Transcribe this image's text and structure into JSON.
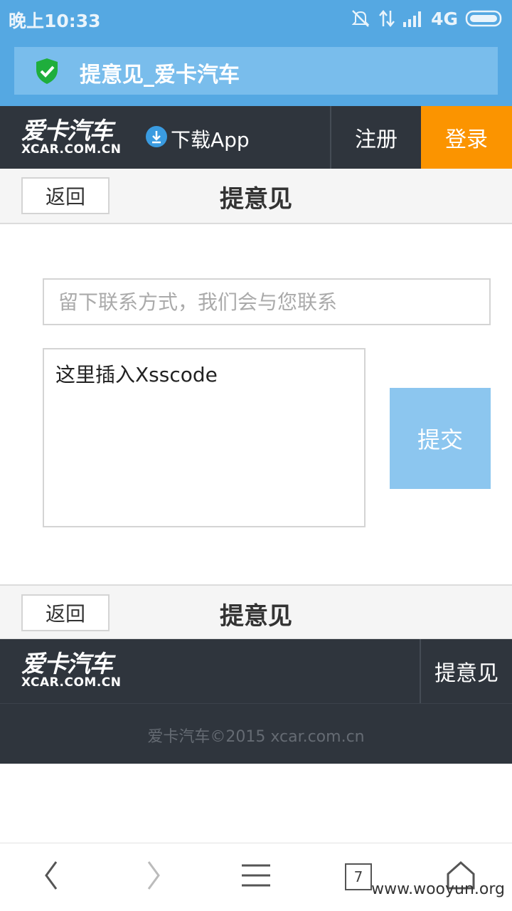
{
  "status_bar": {
    "time": "晚上10:33",
    "network": "4G"
  },
  "url_bar": {
    "title": "提意见_爱卡汽车",
    "shield_color": "#1fae3c"
  },
  "header": {
    "logo_cn": "爱卡汽车",
    "logo_en": "XCAR.COM.CN",
    "download_label": "下载App",
    "register_label": "注册",
    "login_label": "登录",
    "login_color": "#fb9400"
  },
  "title_bar": {
    "back_label": "返回",
    "title": "提意见"
  },
  "form": {
    "contact_placeholder": "留下联系方式，我们会与您联系",
    "feedback_value": "这里插入Xsscode",
    "submit_label": "提交"
  },
  "bottom_title_bar": {
    "back_label": "返回",
    "title": "提意见"
  },
  "footer": {
    "logo_cn": "爱卡汽车",
    "logo_en": "XCAR.COM.CN",
    "feedback_label": "提意见",
    "copyright": "爱卡汽车©2015    xcar.com.cn"
  },
  "browser_bar": {
    "tabs_count": "7"
  },
  "watermark": "www.wooyun.org"
}
